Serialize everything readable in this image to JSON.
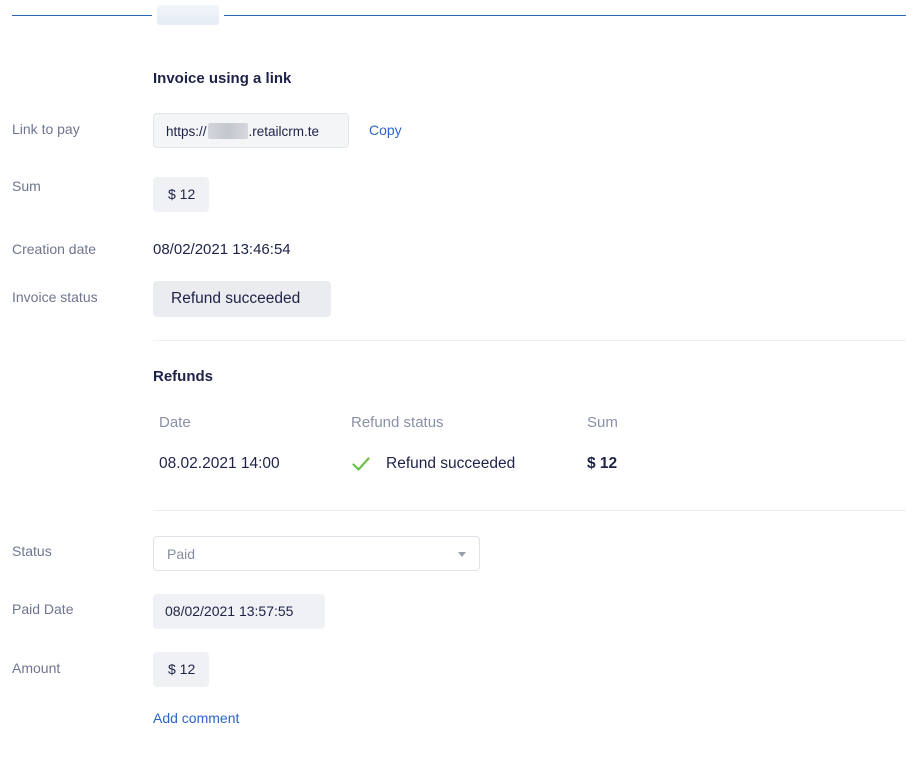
{
  "invoice": {
    "title": "Invoice using a link",
    "link_label": "Link to pay",
    "link_prefix": "https://",
    "link_suffix": ".retailcrm.te",
    "copy_label": "Copy",
    "sum_label": "Sum",
    "sum_value": "$ 12",
    "creation_date_label": "Creation date",
    "creation_date_value": "08/02/2021 13:46:54",
    "status_label": "Invoice status",
    "status_value": "Refund succeeded"
  },
  "refunds": {
    "title": "Refunds",
    "columns": [
      "Date",
      "Refund status",
      "Sum"
    ],
    "rows": [
      {
        "date": "08.02.2021 14:00",
        "status": "Refund succeeded",
        "sum": "$ 12",
        "status_icon": "check-icon"
      }
    ]
  },
  "payment": {
    "status_label": "Status",
    "status_value": "Paid",
    "paid_date_label": "Paid Date",
    "paid_date_value": "08/02/2021 13:57:55",
    "amount_label": "Amount",
    "amount_value": "$ 12",
    "add_comment_label": "Add comment"
  },
  "colors": {
    "accent": "#2a66c8",
    "success": "#6cc04a",
    "text": "#1e2248",
    "muted": "#6e7590"
  }
}
